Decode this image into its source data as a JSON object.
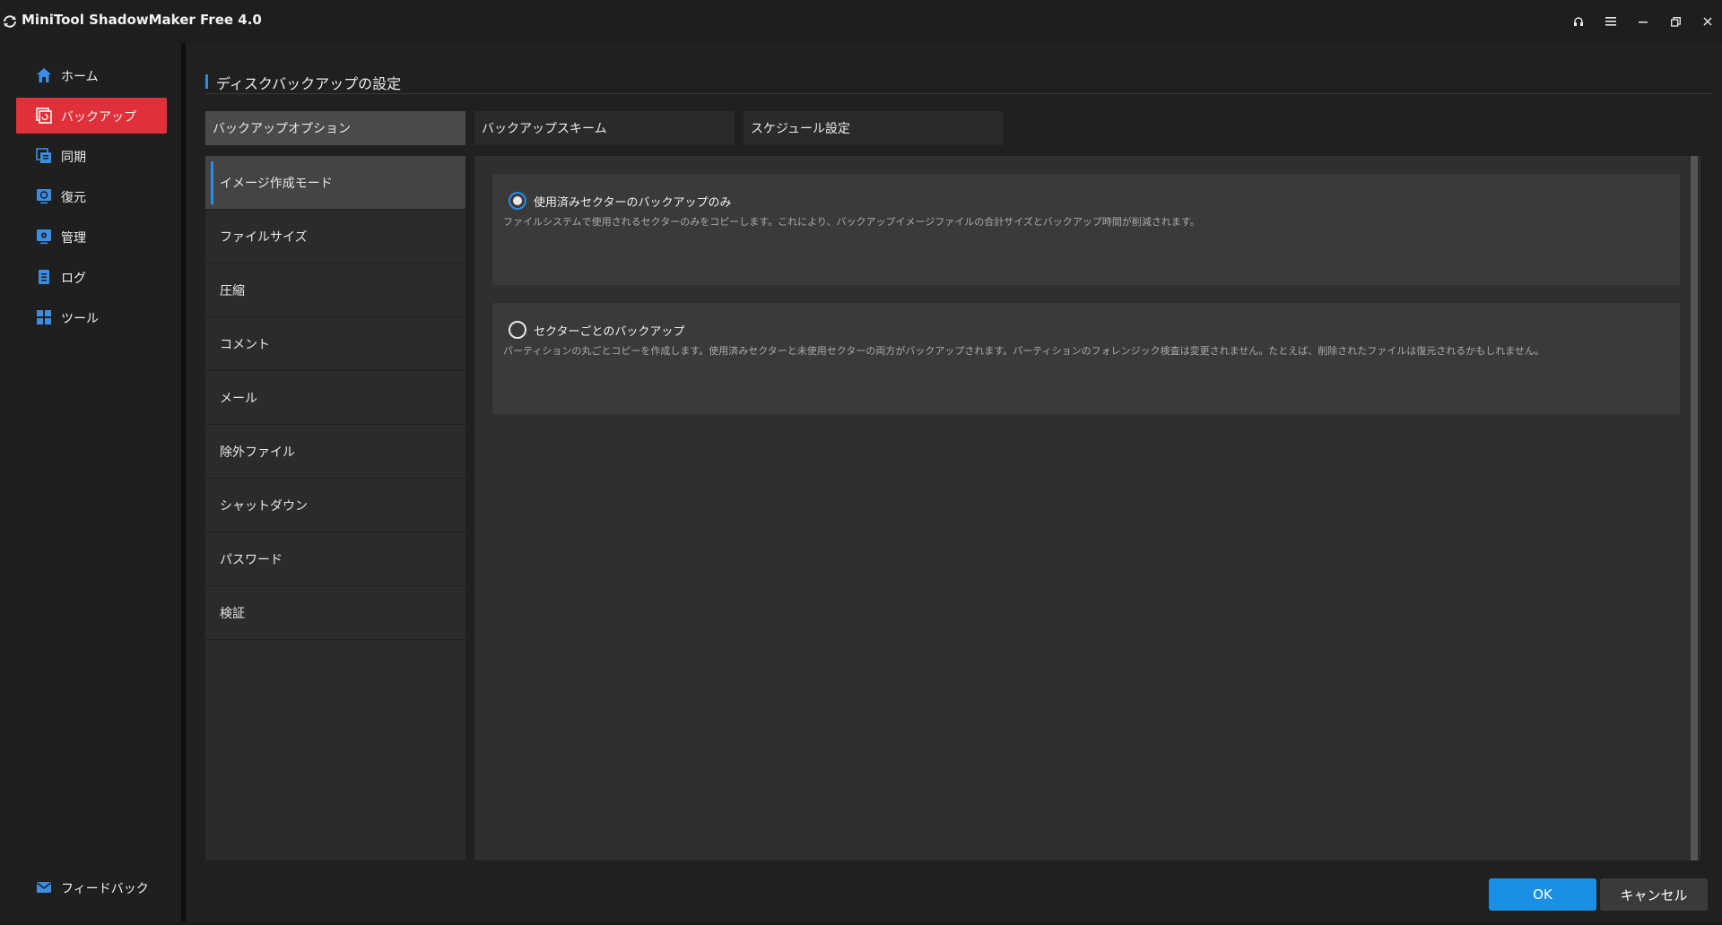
{
  "window": {
    "title": "MiniTool ShadowMaker Free 4.0",
    "controls": [
      "headset-icon",
      "menu-icon",
      "minimize-icon",
      "restore-icon",
      "close-icon"
    ]
  },
  "sidebar": {
    "items": [
      {
        "label": "ホーム",
        "icon": "home-icon"
      },
      {
        "label": "バックアップ",
        "icon": "backup-icon",
        "active": true
      },
      {
        "label": "同期",
        "icon": "sync-icon"
      },
      {
        "label": "復元",
        "icon": "restore-icon"
      },
      {
        "label": "管理",
        "icon": "manage-icon"
      },
      {
        "label": "ログ",
        "icon": "log-icon"
      },
      {
        "label": "ツール",
        "icon": "tools-icon"
      }
    ],
    "feedback": {
      "label": "フィードバック",
      "icon": "mail-icon"
    }
  },
  "main": {
    "title": "ディスクバックアップの設定",
    "tabs": [
      {
        "label": "バックアップオプション",
        "active": true
      },
      {
        "label": "バックアップスキーム"
      },
      {
        "label": "スケジュール設定"
      }
    ],
    "options": [
      {
        "label": "イメージ作成モード",
        "active": true
      },
      {
        "label": "ファイルサイズ"
      },
      {
        "label": "圧縮"
      },
      {
        "label": "コメント"
      },
      {
        "label": "メール"
      },
      {
        "label": "除外ファイル"
      },
      {
        "label": "シャットダウン"
      },
      {
        "label": "パスワード"
      },
      {
        "label": "検証"
      }
    ],
    "modes": [
      {
        "title": "使用済みセクターのバックアップのみ",
        "description": "ファイルシステムで使用されるセクターのみをコピーします。これにより、バックアップイメージファイルの合計サイズとバックアップ時間が削減されます。",
        "selected": true
      },
      {
        "title": "セクターごとのバックアップ",
        "description": "パーティションの丸ごとコピーを作成します。使用済みセクターと未使用セクターの両方がバックアップされます。パーティションのフォレンジック検査は変更されません。たとえば、削除されたファイルは復元されるかもしれません。",
        "selected": false
      }
    ]
  },
  "footer": {
    "ok_label": "OK",
    "cancel_label": "キャンセル"
  },
  "colors": {
    "accent": "#1a8fe3",
    "active_nav": "#e0313a",
    "background": "#202020"
  }
}
